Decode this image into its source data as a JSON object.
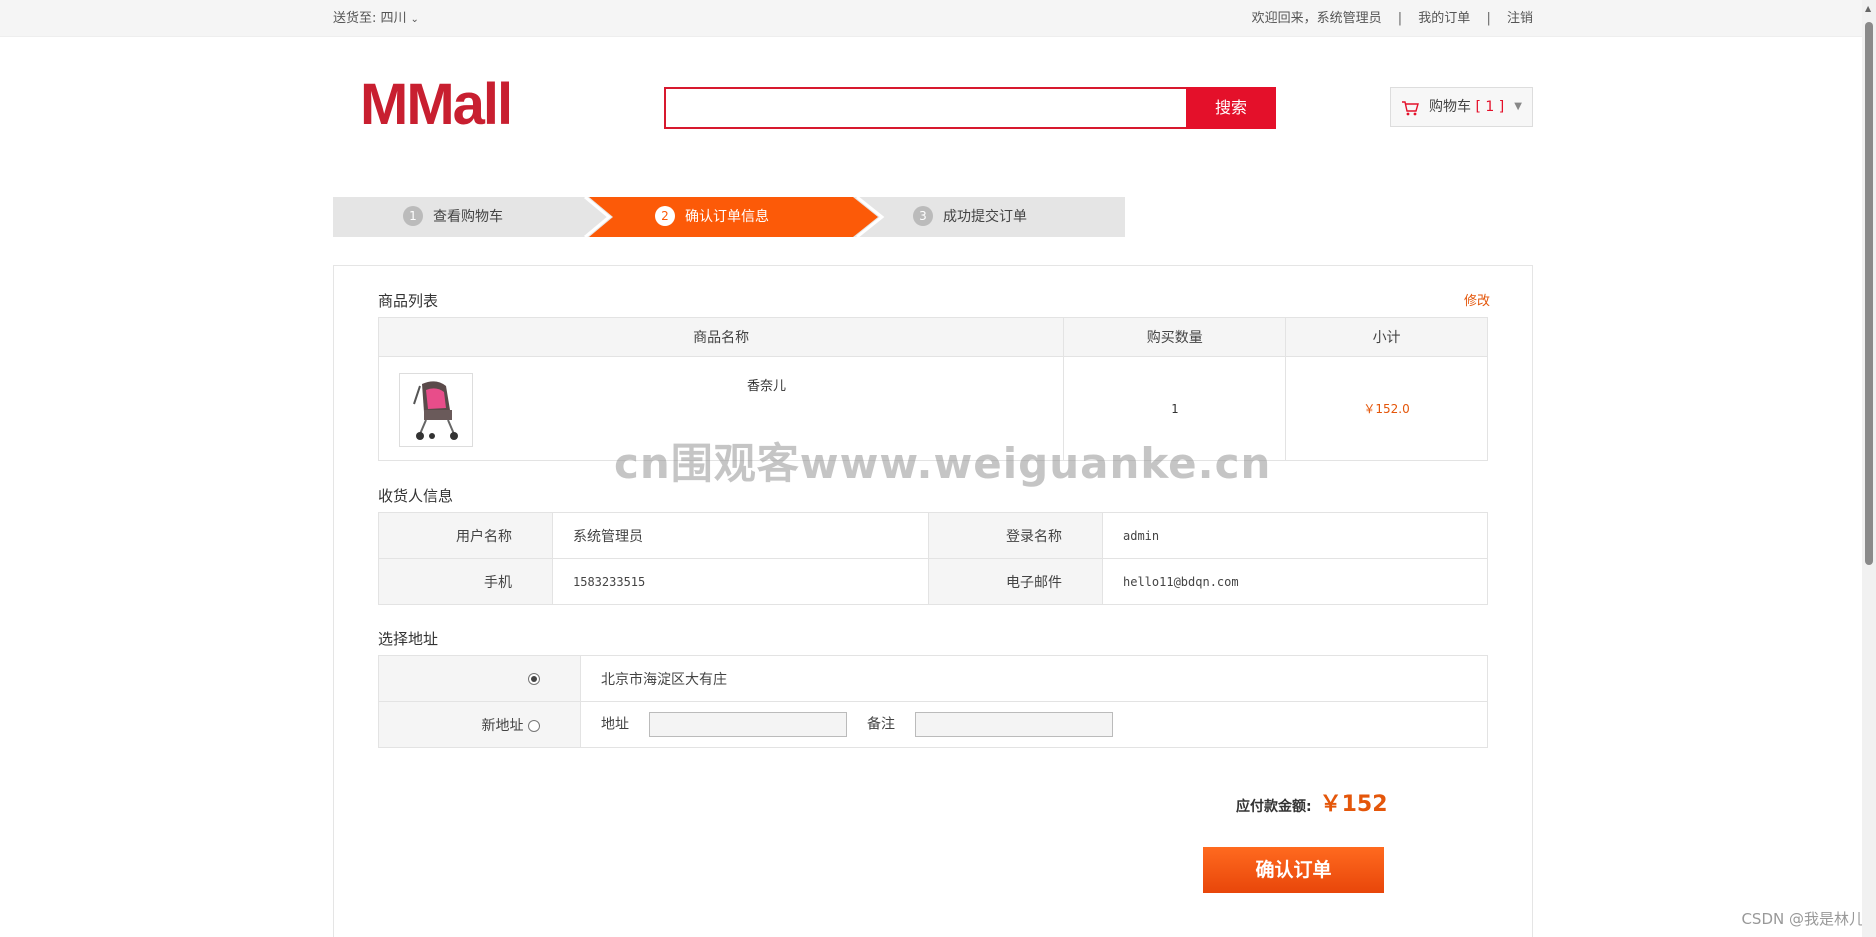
{
  "topbar": {
    "ship_to": "送货至: 四川",
    "welcome": "欢迎回来，系统管理员",
    "my_orders": "我的订单",
    "logout": "注销",
    "separator": "|"
  },
  "header": {
    "logo": "MMall",
    "search_value": "",
    "search_button": "搜索",
    "cart_label": "购物车",
    "cart_count": "[ 1 ]"
  },
  "steps": [
    {
      "num": "1",
      "label": "查看购物车"
    },
    {
      "num": "2",
      "label": "确认订单信息"
    },
    {
      "num": "3",
      "label": "成功提交订单"
    }
  ],
  "goods": {
    "title": "商品列表",
    "edit": "修改",
    "headers": [
      "商品名称",
      "购买数量",
      "小计"
    ],
    "rows": [
      {
        "name": "香奈儿",
        "qty": "1",
        "subtotal": "￥152.0"
      }
    ]
  },
  "receiver": {
    "title": "收货人信息",
    "username_label": "用户名称",
    "username": "系统管理员",
    "login_label": "登录名称",
    "login": "admin",
    "phone_label": "手机",
    "phone": "1583233515",
    "email_label": "电子邮件",
    "email": "hello11@bdqn.com"
  },
  "address": {
    "title": "选择地址",
    "existing": "北京市海淀区大有庄",
    "new_label": "新地址",
    "addr_label": "地址",
    "note_label": "备注"
  },
  "summary": {
    "label": "应付款金额:",
    "amount": "￥152",
    "confirm": "确认订单"
  },
  "watermark": "cn围观客www.weiguanke.cn",
  "credit": "CSDN @我是林儿",
  "colors": {
    "brand_red": "#c81f30",
    "accent_orange": "#fc5a08",
    "price_orange": "#e4560a"
  }
}
